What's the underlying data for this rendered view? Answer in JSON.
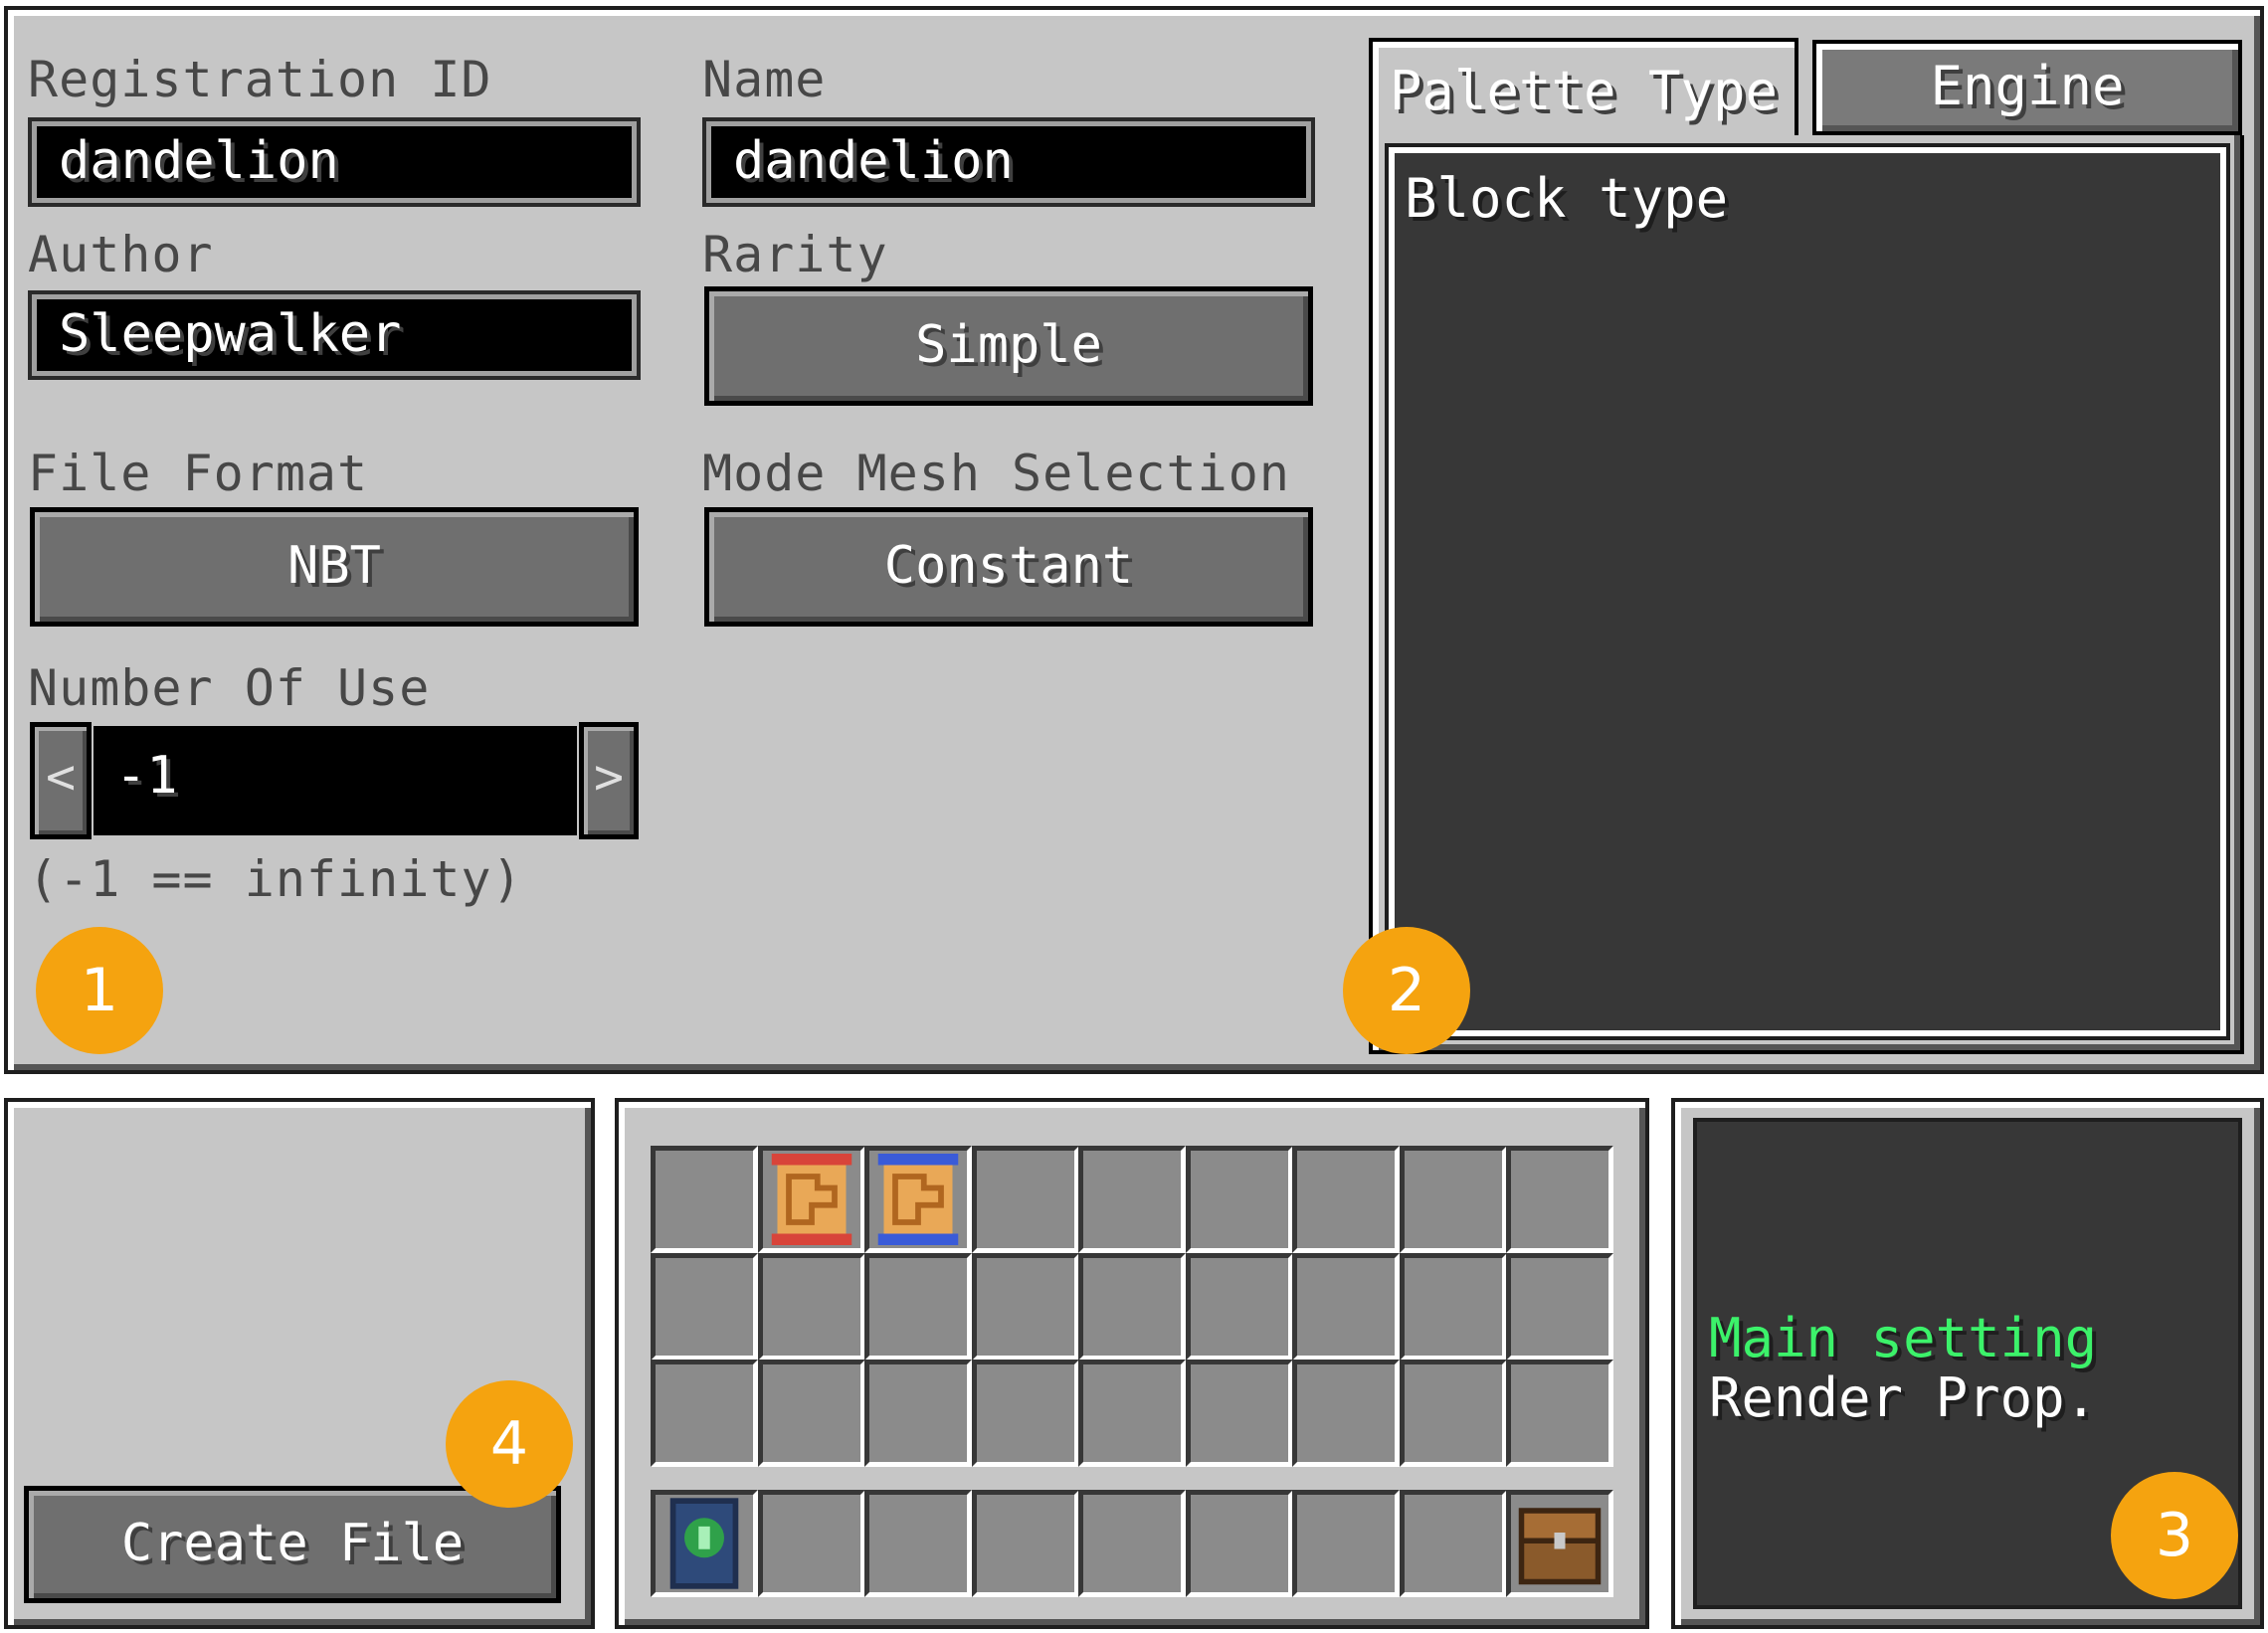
{
  "form": {
    "registration_id_label": "Registration ID",
    "registration_id_value": "dandelion",
    "name_label": "Name",
    "name_value": "dandelion",
    "author_label": "Author",
    "author_value": "Sleepwalker",
    "rarity_label": "Rarity",
    "rarity_value": "Simple",
    "file_format_label": "File Format",
    "file_format_value": "NBT",
    "mode_mesh_label": "Mode Mesh Selection",
    "mode_mesh_value": "Constant",
    "number_of_use_label": "Number Of Use",
    "number_of_use_value": "-1",
    "decrement_glyph": "<",
    "increment_glyph": ">",
    "number_of_use_hint": "(-1 == infinity)"
  },
  "tabs": [
    {
      "label": "Palette Type",
      "active": true
    },
    {
      "label": "Engine",
      "active": false
    }
  ],
  "palette_panel": {
    "content": "Block type"
  },
  "settings_menu": {
    "items": [
      {
        "label": "Main setting",
        "color": "#3cf26a"
      },
      {
        "label": "Render Prop.",
        "color": "#ffffff"
      }
    ]
  },
  "create_button": {
    "label": "Create File"
  },
  "inventory": {
    "items": [
      {
        "icon": "blueprint-scroll-red-icon",
        "row": 0,
        "col": 1
      },
      {
        "icon": "blueprint-scroll-blue-icon",
        "row": 0,
        "col": 2
      },
      {
        "icon": "guide-book-icon",
        "row": 3,
        "col": 0
      },
      {
        "icon": "chest-icon",
        "row": 3,
        "col": 8
      }
    ]
  },
  "annotations": [
    "1",
    "2",
    "3",
    "4"
  ],
  "colors": {
    "panel": "#c6c6c6",
    "dark": "#373737",
    "accent_green": "#3cf26a",
    "badge": "#f5a30f"
  }
}
